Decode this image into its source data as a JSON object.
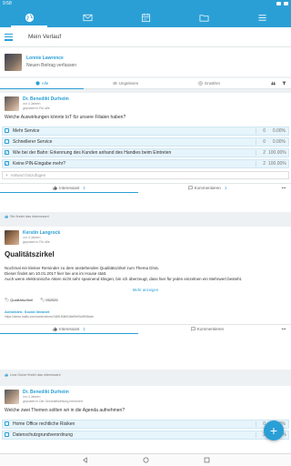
{
  "status": {
    "time": "9:58"
  },
  "header": {
    "title": "Mein Verlauf"
  },
  "composer": {
    "name": "Lonnie Lawrence",
    "prompt": "Neuen Beitrag verfassen"
  },
  "filters": {
    "tabs": [
      "Alle",
      "Ungelesen",
      "Erwähnt"
    ]
  },
  "post1": {
    "author": "Dr. Benedikt Durheim",
    "time": "vor 4 Jahren",
    "where": "gepostet in Für alle",
    "question": "Welche Auswirkungen könnte IoT für unsere Filialen haben?",
    "options": [
      {
        "label": "Mehr Service",
        "count": "0",
        "pct": "0.00%",
        "checked": false
      },
      {
        "label": "Schnellerer Service",
        "count": "0",
        "pct": "0.00%",
        "checked": false
      },
      {
        "label": "Wie bei der Bahn: Erkennung des Kunden anhand des Handies beim Eintreten",
        "count": "2",
        "pct": "100.00%",
        "checked": true
      },
      {
        "label": "Keine PIN-Eingabe mehr?",
        "count": "2",
        "pct": "100.00%",
        "checked": true
      }
    ],
    "add_answer": "Antwort hinzufügen",
    "interesting": "Interessant",
    "interesting_count": "1",
    "comment": "Kommentieren",
    "comment_count": "1",
    "liked_by": "Sie findet das interessant"
  },
  "post2": {
    "author": "Kerstin Langrock",
    "time": "vor 4 Jahren",
    "where": "gepostet in Für alle",
    "title": "Qualitätszirkel",
    "body_lines": [
      "Nochmal ein kleiner Reminder zu dem anstehenden Qualitätszirkel zum Thema DiVa.",
      "Dieser findet am 10.01.2017 hier bei uns im House statt.",
      "Auch wenn elektronische Akten nicht sehr spannend klingen, bin ich überzeugt, dass hier für jeden einzelnen ein Mehrwert besteht."
    ],
    "show_more": "Mehr anzeigen",
    "tags": [
      "Qualitätszirkel",
      "052025"
    ],
    "attach_label": "Anmelden: Social Intranet",
    "attach_url": "https://demo.haiilo.com/content/cms/7d8f1506f046ef0bf9c0f908cde",
    "interesting": "Interessant",
    "interesting_count": "1",
    "comment": "Kommentieren",
    "liked_by": "Lina Gotze findet das interessant"
  },
  "post3": {
    "author": "Dr. Benedikt Durheim",
    "time": "vor 4 Jahren",
    "where": "gepostet in Die Geschäftsleitung informiert",
    "question": "Welche zwei Themen sollten wir in die Agenda aufnehmen?",
    "options": [
      {
        "label": "Home Office rechtliche Risiken",
        "count": "0",
        "pct": "0.00%"
      },
      {
        "label": "Datenschutzgrundverordnung",
        "count": "2",
        "pct": "100.00%"
      }
    ]
  },
  "colors": {
    "accent": "#2a9fd6"
  }
}
